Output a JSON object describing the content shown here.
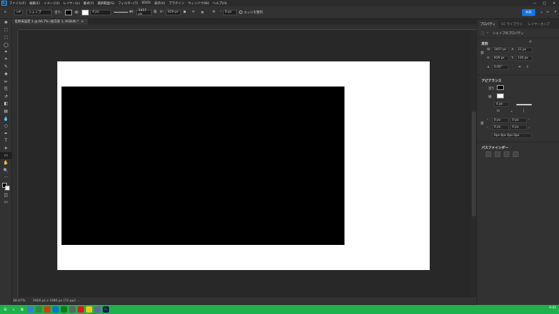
{
  "menubar": {
    "logo": "Ps",
    "items": [
      "ファイル(F)",
      "編集(E)",
      "イメージ(I)",
      "レイヤー(L)",
      "書式(Y)",
      "選択範囲(S)",
      "フィルター(T)",
      "3D(D)",
      "表示(V)",
      "プラグイン",
      "ウィンドウ(W)",
      "ヘルプ(H)"
    ],
    "window_controls": [
      "—",
      "□",
      "✕"
    ]
  },
  "optionsbar": {
    "mode": "シェイプ",
    "fill_label": "塗り:",
    "stroke_label": "線:",
    "stroke_width": "4 px",
    "w_label": "W:",
    "w_value": "1457 px",
    "link_icon": "link-icon",
    "h_label": "H:",
    "h_value": "819 px",
    "radius_value": "0 px",
    "align_edges_label": "エッジを整列",
    "share_label": "共有"
  },
  "document": {
    "tab_title": "名称未設定 1 @ 66.7% (長方形 1, RGB/8) *",
    "status_zoom": "66.67%",
    "status_info": "1920 px x 1080 px (72 ppi)",
    "canvas_color": "#ffffff",
    "shape_color": "#000000"
  },
  "toolbar": {
    "tools": [
      "move-tool",
      "artboard-tool",
      "marquee-tool",
      "lasso-tool",
      "object-select-tool",
      "crop-tool",
      "eyedropper-tool",
      "healing-tool",
      "brush-tool",
      "stamp-tool",
      "history-brush-tool",
      "eraser-tool",
      "gradient-tool",
      "blur-tool",
      "dodge-tool",
      "pen-tool",
      "type-tool",
      "path-select-tool",
      "rectangle-tool",
      "hand-tool",
      "zoom-tool",
      "more-tools"
    ],
    "glyphs": [
      "✥",
      "⬚",
      "⬚",
      "◯",
      "✦",
      "⌗",
      "✎",
      "✚",
      "✏",
      "⎘",
      "↺",
      "◧",
      "▤",
      "💧",
      "○",
      "✒",
      "T",
      "➤",
      "▭",
      "✋",
      "🔍",
      "···"
    ]
  },
  "panel": {
    "tabs": [
      "プロパティ",
      "CC ライブラリ",
      "レイヤーカンプ"
    ],
    "title": "シェイプのプロパティ",
    "transform": {
      "header": "変形",
      "w_label": "W",
      "w_value": "1457 px",
      "x_label": "X",
      "x_value": "21 px",
      "h_label": "H",
      "h_value": "819 px",
      "y_label": "Y",
      "y_value": "130 px",
      "angle_value": "0.00°"
    },
    "appearance": {
      "header": "アピアランス",
      "fill_label": "塗り",
      "stroke_label": "線",
      "stroke_width": "4 px",
      "corner_values": [
        "0 px",
        "0 px",
        "0 px",
        "0 px"
      ],
      "corner_combined": "0px 0px 0px 0px"
    },
    "pathfinder": {
      "header": "パスファインダー"
    }
  },
  "taskbar": {
    "time": "9:41"
  },
  "colors": {
    "accent": "#1473e6",
    "taskbar": "#1fb14a",
    "ps_blue": "#31a8ff"
  }
}
